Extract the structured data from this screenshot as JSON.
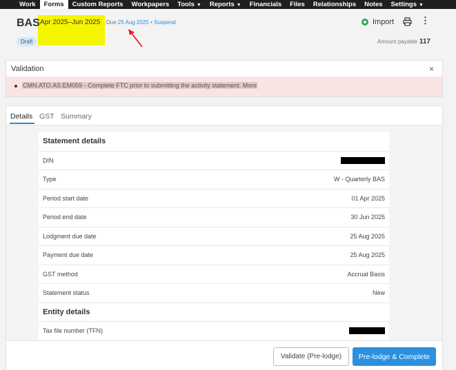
{
  "nav": {
    "items": [
      {
        "label": "Work",
        "active": false,
        "caret": false
      },
      {
        "label": "Forms",
        "active": true,
        "caret": false
      },
      {
        "label": "Custom Reports",
        "active": false,
        "caret": false
      },
      {
        "label": "Workpapers",
        "active": false,
        "caret": false
      },
      {
        "label": "Tools",
        "active": false,
        "caret": true
      },
      {
        "label": "Reports",
        "active": false,
        "caret": true
      },
      {
        "label": "Financials",
        "active": false,
        "caret": false
      },
      {
        "label": "Files",
        "active": false,
        "caret": false
      },
      {
        "label": "Relationships",
        "active": false,
        "caret": false
      },
      {
        "label": "Notes",
        "active": false,
        "caret": false
      },
      {
        "label": "Settings",
        "active": false,
        "caret": true
      }
    ]
  },
  "header": {
    "title": "BAS",
    "period": "Apr 2025–Jun 2025",
    "due_prefix": "Due",
    "due_date": "25 Aug 2025",
    "separator": "•",
    "suspend": "Suspend",
    "import_label": "Import",
    "more_glyph": "⋮",
    "status_badge": "Draft",
    "amount_label": "Amount payable",
    "amount_value": "117"
  },
  "validation": {
    "title": "Validation",
    "close_glyph": "×",
    "message": "CMN.ATO.AS.EM059 - Complete FTC prior to submitting the activity statement. More"
  },
  "tabs": [
    {
      "label": "Details"
    },
    {
      "label": "GST"
    },
    {
      "label": "Summary"
    }
  ],
  "statement": {
    "section_title": "Statement details",
    "din_label": "DIN",
    "type_label": "Type",
    "type_value": "W - Quarterly BAS",
    "period_start_label": "Period start date",
    "period_start_value": "01 Apr 2025",
    "period_end_label": "Period end date",
    "period_end_value": "30 Jun 2025",
    "lodgment_due_label": "Lodgment due date",
    "lodgment_due_value": "25 Aug 2025",
    "payment_due_label": "Payment due date",
    "payment_due_value": "25 Aug 2025",
    "gst_method_label": "GST method",
    "gst_method_value": "Accrual Basis",
    "status_label": "Statement status",
    "status_value": "New"
  },
  "entity": {
    "section_title": "Entity details",
    "tfn_label": "Tax file number (TFN)"
  },
  "footer": {
    "validate_label": "Validate (Pre-lodge)",
    "complete_label": "Pre-lodge & Complete"
  },
  "colors": {
    "nav_bg": "#1f1f1f",
    "highlight": "#f5f500",
    "accent": "#2b90e0",
    "error_bg": "#f9e4e4",
    "import_icon": "#2fa84f",
    "annotation_arrow": "#e02020"
  }
}
